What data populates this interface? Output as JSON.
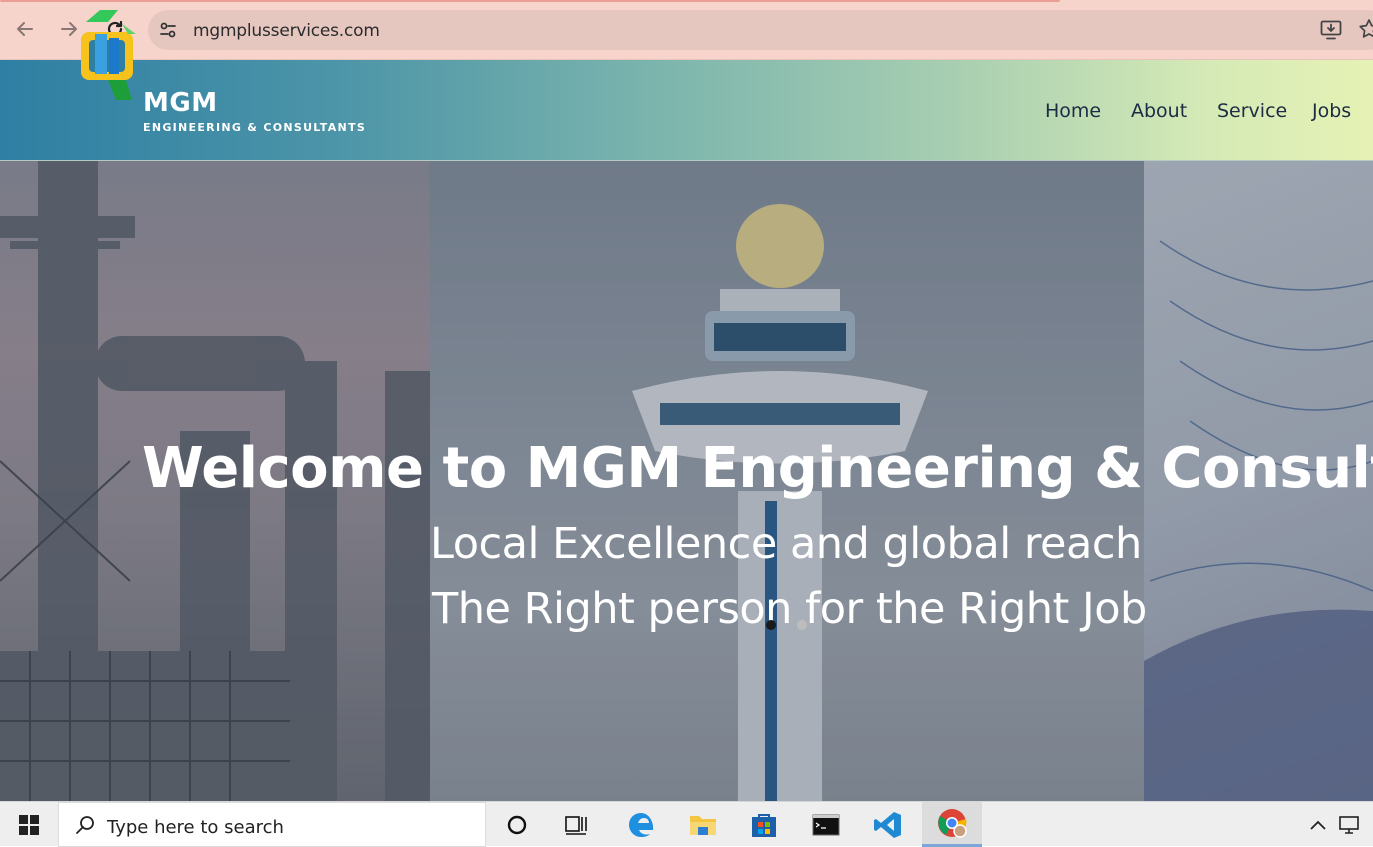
{
  "browser": {
    "url": "mgmplusservices.com"
  },
  "site": {
    "logo": {
      "name": "MGM",
      "tagline": "ENGINEERING & CONSULTANTS"
    },
    "nav": [
      {
        "label": "Home"
      },
      {
        "label": "About"
      },
      {
        "label": "Service"
      },
      {
        "label": "Jobs"
      }
    ],
    "hero": {
      "title": "Welcome to MGM Engineering & Consultants",
      "line1": "Local Excellence and global reach",
      "line2": "The Right person for the Right Job",
      "slides": 2,
      "active_slide": 1
    }
  },
  "taskbar": {
    "search_placeholder": "Type here to search",
    "apps": [
      "cortana-icon",
      "task-view-icon",
      "edge-icon",
      "file-explorer-icon",
      "store-icon",
      "terminal-icon",
      "vscode-icon",
      "chrome-icon"
    ]
  },
  "colors": {
    "chrome_bg": "#f6d4cc",
    "omnibox_bg": "#e6c7c0",
    "nav_text": "#1d2b44",
    "header_start": "#2e7fa4",
    "header_end": "#e6f2b5"
  }
}
